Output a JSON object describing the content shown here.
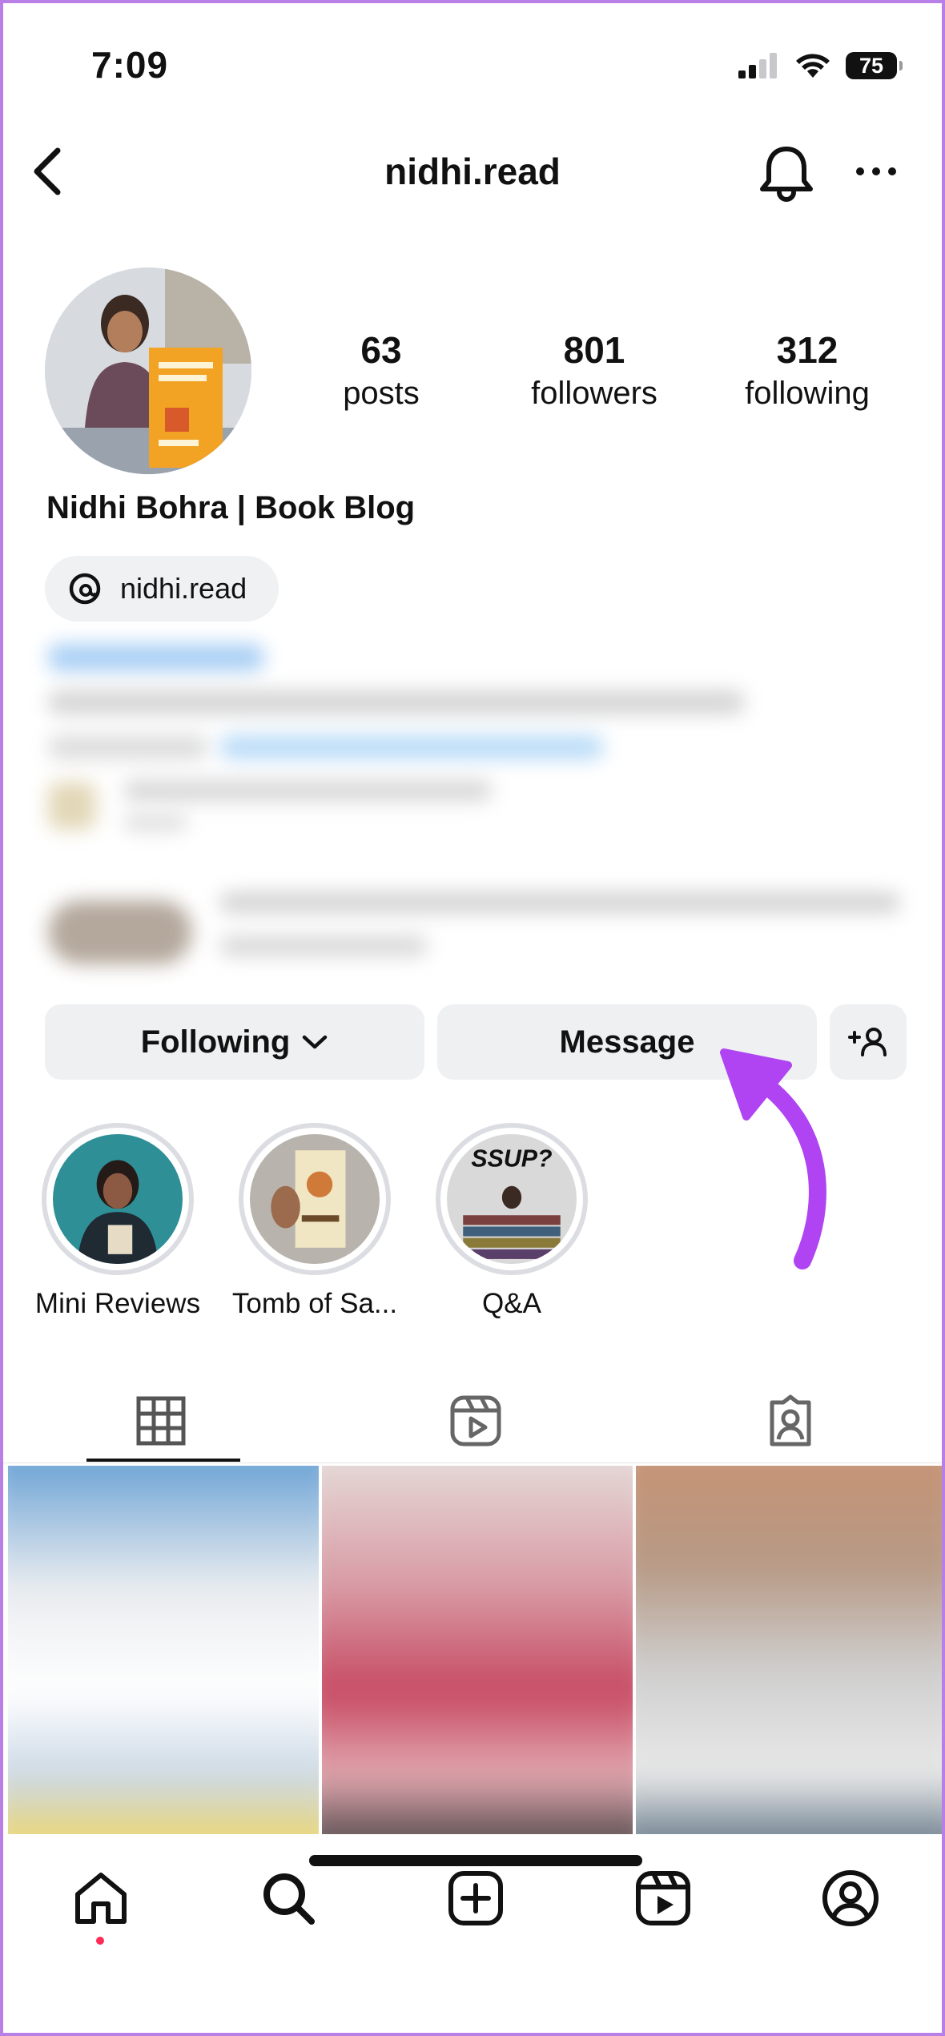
{
  "status_bar": {
    "time": "7:09",
    "battery": "75"
  },
  "nav": {
    "title": "nidhi.read"
  },
  "profile": {
    "full_name": "Nidhi Bohra | Book Blog",
    "threads_handle": "nidhi.read",
    "stats": [
      {
        "value": "63",
        "label": "posts"
      },
      {
        "value": "801",
        "label": "followers"
      },
      {
        "value": "312",
        "label": "following"
      }
    ]
  },
  "actions": {
    "following_label": "Following",
    "message_label": "Message"
  },
  "highlights": [
    {
      "label": "Mini Reviews"
    },
    {
      "label": "Tomb of Sa..."
    },
    {
      "label": "Q&A"
    }
  ],
  "tabs": [
    "posts-grid",
    "reels",
    "tagged"
  ],
  "colors": {
    "accent_arrow": "#b044f2",
    "border": "#b87fe6",
    "notification_dot": "#ff2d55"
  }
}
